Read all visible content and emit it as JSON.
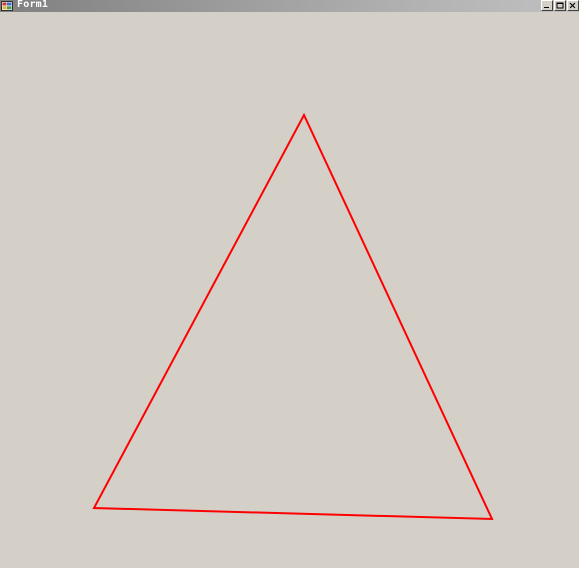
{
  "window": {
    "title": "Form1"
  },
  "canvas": {
    "shape": "triangle",
    "stroke_color": "#ff0000",
    "background_color": "#d4d0c8"
  },
  "icons": {
    "app": "app-icon",
    "minimize": "minimize-icon",
    "maximize": "maximize-icon",
    "close": "close-icon"
  }
}
